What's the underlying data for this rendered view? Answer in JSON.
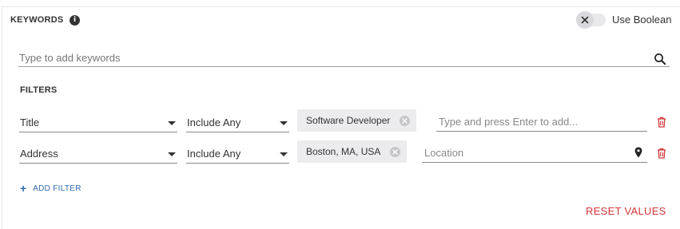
{
  "header": {
    "title": "KEYWORDS",
    "info_icon_glyph": "i",
    "boolean_label": "Use Boolean",
    "boolean_enabled": false
  },
  "keywords": {
    "placeholder": "Type to add keywords",
    "value": ""
  },
  "filters": {
    "title": "FILTERS",
    "rows": [
      {
        "field": "Title",
        "operator": "Include Any",
        "chips": [
          "Software Developer"
        ],
        "placeholder": "Type and press Enter to add...",
        "has_location_icon": false
      },
      {
        "field": "Address",
        "operator": "Include Any",
        "chips": [
          "Boston, MA, USA"
        ],
        "placeholder": "Location",
        "has_location_icon": true
      }
    ],
    "add_label": "ADD FILTER",
    "add_glyph": "+"
  },
  "reset_label": "RESET VALUES",
  "colors": {
    "accent_blue": "#2f6bb0",
    "danger_red": "#d2343a",
    "chip_bg": "#ececee"
  },
  "icons": [
    "info-icon",
    "close-icon",
    "search-icon",
    "chevron-down-icon",
    "location-pin-icon",
    "trash-icon",
    "plus-icon"
  ]
}
